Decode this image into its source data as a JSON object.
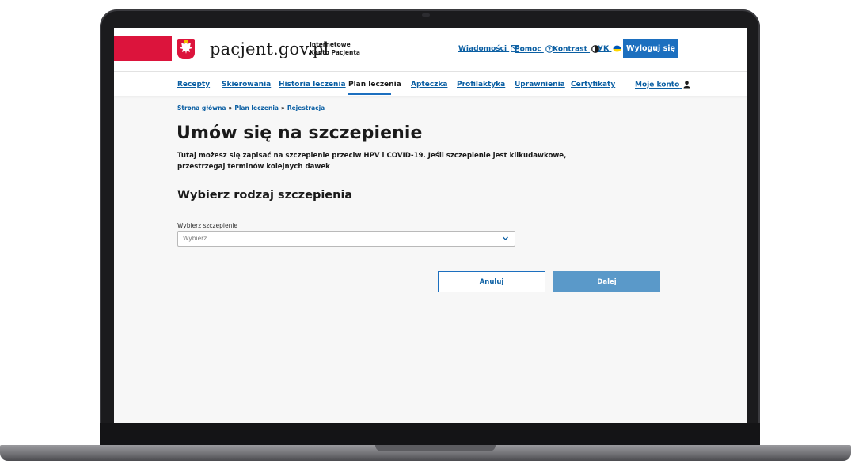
{
  "header": {
    "site_name": "pacjent.gov.pl",
    "site_subtitle_line1": "Internetowe",
    "site_subtitle_line2": "Konto Pacjenta",
    "links": {
      "messages": "Wiadomości",
      "help": "Pomoc",
      "contrast": "Kontrast",
      "language": "УК"
    },
    "logout_label": "Wyloguj się"
  },
  "nav": {
    "items": [
      {
        "label": "Recepty",
        "icon": ""
      },
      {
        "label": "Skierowania",
        "icon": ""
      },
      {
        "label": "Historia leczenia",
        "icon": ""
      },
      {
        "label": "Plan leczenia",
        "icon": ""
      },
      {
        "label": "Apteczka",
        "icon": ""
      },
      {
        "label": "Profilaktyka",
        "icon": ""
      },
      {
        "label": "Uprawnienia",
        "icon": ""
      },
      {
        "label": "Certyfikaty",
        "icon": ""
      },
      {
        "label": "Moje konto",
        "icon": "user-icon"
      }
    ],
    "active": "Plan leczenia"
  },
  "breadcrumb": {
    "items": [
      "Strona główna",
      "Plan leczenia",
      "Rejestracja"
    ],
    "separator": "»"
  },
  "main": {
    "title": "Umów się na szczepienie",
    "intro": "Tutaj możesz się zapisać na szczepienie przeciw HPV i COVID-19. Jeśli szczepienie jest kilkudawkowe, przestrzegaj terminów kolejnych dawek",
    "section_title": "Wybierz rodzaj szczepienia",
    "select": {
      "label": "Wybierz szczepienie",
      "placeholder": "Wybierz"
    },
    "buttons": {
      "cancel": "Anuluj",
      "next": "Dalej"
    }
  },
  "colors": {
    "flag_red": "#dc143c",
    "link_blue": "#0b5fa3",
    "primary_blue": "#1c6fbf",
    "disabled_blue": "#5a99c9"
  }
}
